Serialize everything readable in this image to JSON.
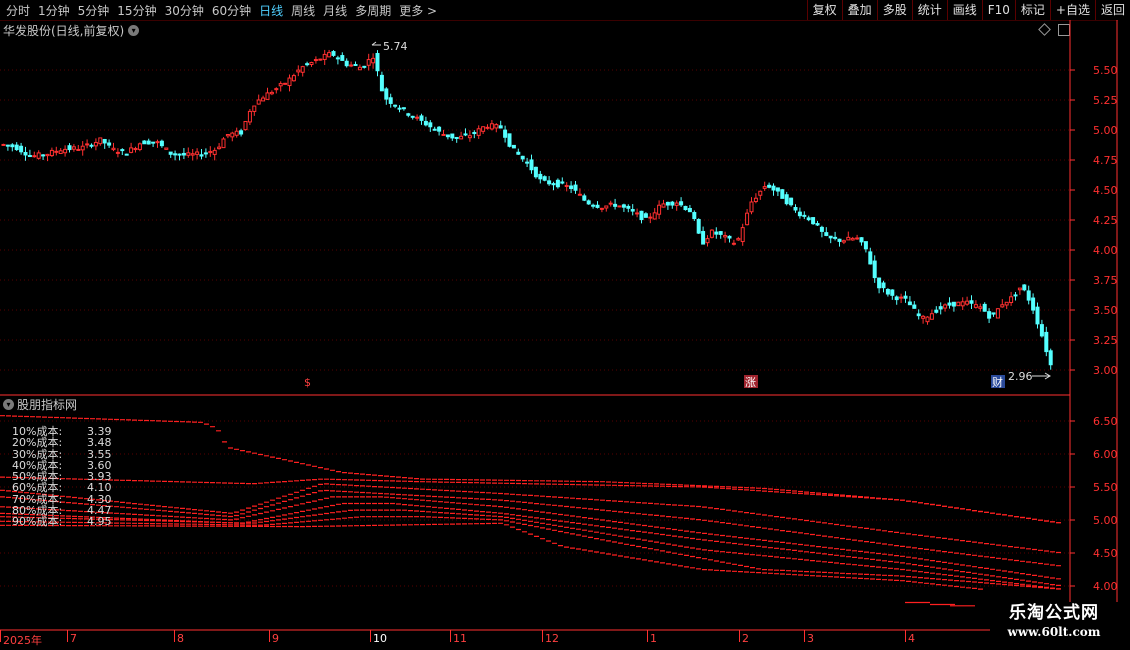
{
  "toolbar": {
    "periods": [
      "分时",
      "1分钟",
      "5分钟",
      "15分钟",
      "30分钟",
      "60分钟",
      "日线",
      "周线",
      "月线",
      "多周期",
      "更多 >"
    ],
    "active_period": "日线",
    "buttons": [
      "复权",
      "叠加",
      "多股",
      "统计",
      "画线",
      "F10",
      "标记",
      "+自选",
      "返回"
    ]
  },
  "main_chart": {
    "title": "华发股份(日线,前复权)",
    "high_label": "5.74",
    "low_label": "2.96",
    "event_markers": [
      "$",
      "涨",
      "财"
    ],
    "y_ticks": [
      "5.50",
      "5.25",
      "5.00",
      "4.75",
      "4.50",
      "4.25",
      "4.00",
      "3.75",
      "3.50",
      "3.25",
      "3.00"
    ]
  },
  "indicator": {
    "title": "股朋指标网",
    "y_ticks": [
      "6.50",
      "6.00",
      "5.50",
      "5.00",
      "4.50",
      "4.00"
    ],
    "legend": [
      {
        "label": "10%成本:",
        "value": "3.39"
      },
      {
        "label": "20%成本:",
        "value": "3.48"
      },
      {
        "label": "30%成本:",
        "value": "3.55"
      },
      {
        "label": "40%成本:",
        "value": "3.60"
      },
      {
        "label": "50%成本:",
        "value": "3.93"
      },
      {
        "label": "60%成本:",
        "value": "4.10"
      },
      {
        "label": "70%成本:",
        "value": "4.30"
      },
      {
        "label": "80%成本:",
        "value": "4.47"
      },
      {
        "label": "90%成本:",
        "value": "4.95"
      }
    ]
  },
  "x_axis": {
    "labels": [
      "2025年",
      "7",
      "8",
      "9",
      "10",
      "11",
      "12",
      "1",
      "2",
      "3",
      "4"
    ],
    "highlighted": "10"
  },
  "watermark": {
    "line1": "乐淘公式网",
    "line2": "www.60lt.com"
  },
  "colors": {
    "up": "#ff3030",
    "down": "#54ffff",
    "grid": "#5a0000",
    "axis": "#ff3030",
    "line": "#ff2020"
  }
}
